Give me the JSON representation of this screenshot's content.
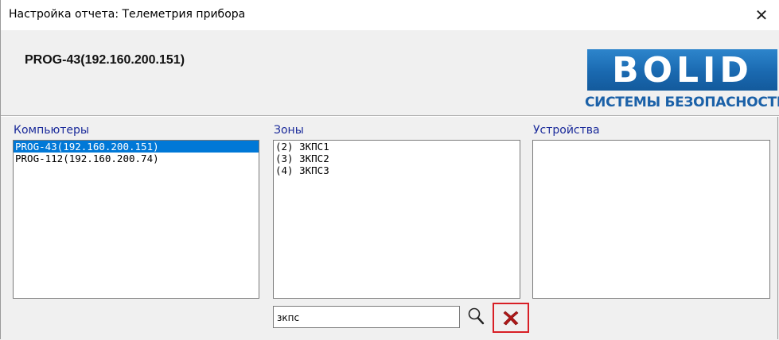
{
  "window": {
    "title": "Настройка отчета: Телеметрия прибора",
    "close_glyph": "✕"
  },
  "header": {
    "device_title": "PROG-43(192.160.200.151)",
    "logo": {
      "letters": "BOLID",
      "subtitle": "СИСТЕМЫ БЕЗОПАСНОСТИ",
      "brand_color": "#1b61a8"
    }
  },
  "panels": {
    "computers": {
      "label": "Компьютеры",
      "items": [
        "PROG-43(192.160.200.151)",
        "PROG-112(192.160.200.74)"
      ],
      "selected_index": 0
    },
    "zones": {
      "label": "Зоны",
      "items": [
        "(2) ЗКПС1",
        "(3) ЗКПС2",
        "(4) ЗКПС3"
      ]
    },
    "devices": {
      "label": "Устройства",
      "items": []
    }
  },
  "search": {
    "value": "зкпс",
    "search_icon": "magnifier-icon",
    "clear_icon": "red-x-icon",
    "highlight_color": "#d81f26"
  },
  "colors": {
    "label_text": "#1a2a9a",
    "selection": "#0078d7"
  }
}
